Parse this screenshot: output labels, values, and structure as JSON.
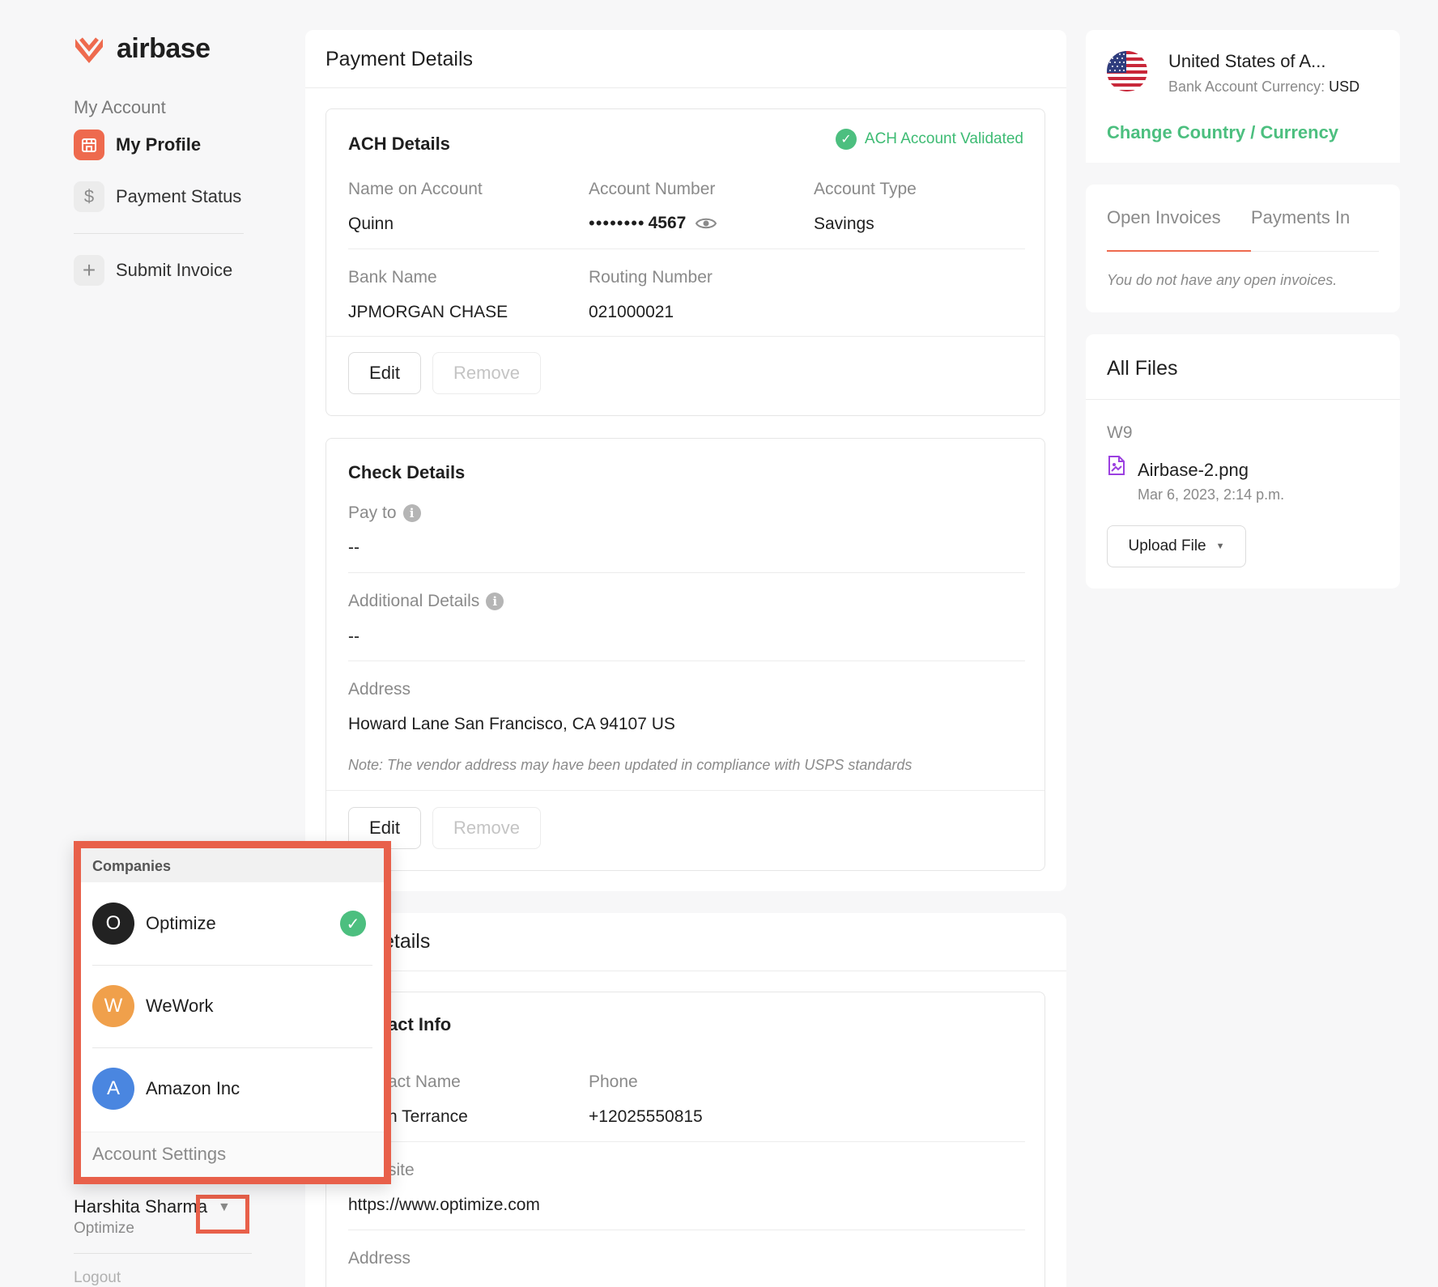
{
  "brand": {
    "name": "airbase",
    "accent": "#ee6a4e",
    "success": "#4cbf7f"
  },
  "sidebar": {
    "section_label": "My Account",
    "items": [
      {
        "label": "My Profile",
        "icon": "storefront-icon"
      },
      {
        "label": "Payment Status",
        "icon": "dollar-icon"
      },
      {
        "label": "Submit Invoice",
        "icon": "plus-icon"
      }
    ],
    "user": {
      "name": "Harshita Sharma",
      "company": "Optimize"
    },
    "logout_label": "Logout"
  },
  "payment_details": {
    "title": "Payment Details",
    "ach": {
      "title": "ACH Details",
      "status": "ACH Account Validated",
      "name_label": "Name on Account",
      "name_value": "Quinn",
      "account_number_label": "Account Number",
      "account_number_mask": "••••••••",
      "account_number_last4": "4567",
      "account_type_label": "Account Type",
      "account_type_value": "Savings",
      "bank_name_label": "Bank Name",
      "bank_name_value": "JPMORGAN CHASE",
      "routing_label": "Routing Number",
      "routing_value": "021000021",
      "edit_label": "Edit",
      "remove_label": "Remove"
    },
    "check": {
      "title": "Check Details",
      "pay_to_label": "Pay to",
      "pay_to_value": "--",
      "additional_label": "Additional Details",
      "additional_value": "--",
      "address_label": "Address",
      "address_value": "Howard Lane San Francisco, CA 94107 US",
      "note": "Note: The vendor address may have been updated in compliance with USPS standards",
      "edit_label": "Edit",
      "remove_label": "Remove"
    }
  },
  "company_details": {
    "title_partial": "etails",
    "contact_title_partial": "act Info",
    "contact_name_label_partial": "act Name",
    "contact_name_value_partial": "n Terrance",
    "phone_label": "Phone",
    "phone_value": "+12025550815",
    "website_label_partial": "site",
    "website_value": "https://www.optimize.com",
    "address_label": "Address"
  },
  "country_card": {
    "country": "United States of A...",
    "currency_label": "Bank Account Currency:",
    "currency_value": "USD",
    "change_link": "Change Country / Currency"
  },
  "invoices_card": {
    "tabs": [
      "Open Invoices",
      "Payments In"
    ],
    "empty_text": "You do not have any open invoices."
  },
  "files_card": {
    "title": "All Files",
    "section": "W9",
    "file_name": "Airbase-2.png",
    "file_date": "Mar 6, 2023, 2:14 p.m.",
    "upload_label": "Upload File"
  },
  "company_dropdown": {
    "header": "Companies",
    "companies": [
      {
        "initial": "O",
        "name": "Optimize",
        "color": "#222222",
        "selected": true
      },
      {
        "initial": "W",
        "name": "WeWork",
        "color": "#f0a04b",
        "selected": false
      },
      {
        "initial": "A",
        "name": "Amazon Inc",
        "color": "#4a86e0",
        "selected": false
      }
    ],
    "footer": "Account Settings"
  }
}
